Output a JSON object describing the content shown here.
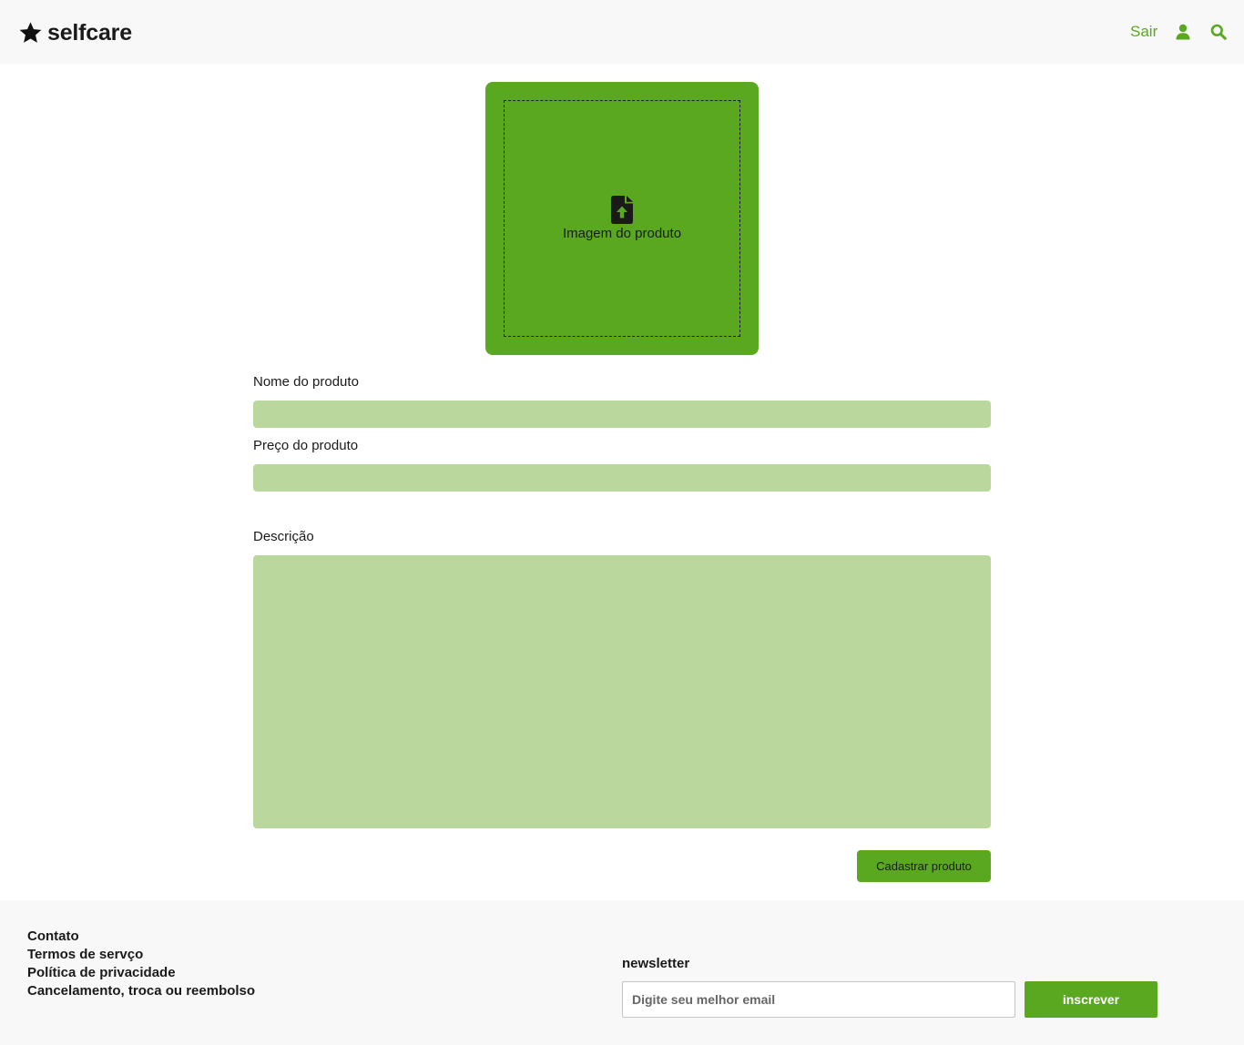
{
  "colors": {
    "accent": "#5aa820",
    "input_bg": "#bad89e",
    "header_bg": "#f8f8f8",
    "text": "#1a1a1a"
  },
  "header": {
    "brand_icon": "star-icon",
    "brand_name": "selfcare",
    "logout_label": "Sair",
    "user_icon": "user-icon",
    "search_icon": "search-icon"
  },
  "upload": {
    "icon": "file-upload-icon",
    "label": "Imagem do produto"
  },
  "form": {
    "name_label": "Nome do produto",
    "name_value": "",
    "price_label": "Preço do produto",
    "price_value": "",
    "description_label": "Descrição",
    "description_value": "",
    "submit_label": "Cadastrar produto"
  },
  "footer": {
    "links": [
      {
        "label": "Contato"
      },
      {
        "label": "Termos de servço"
      },
      {
        "label": "Política de privacidade"
      },
      {
        "label": "Cancelamento, troca ou reembolso"
      }
    ],
    "newsletter": {
      "title": "newsletter",
      "placeholder": "Digite seu melhor email",
      "button_label": "inscrever"
    }
  }
}
